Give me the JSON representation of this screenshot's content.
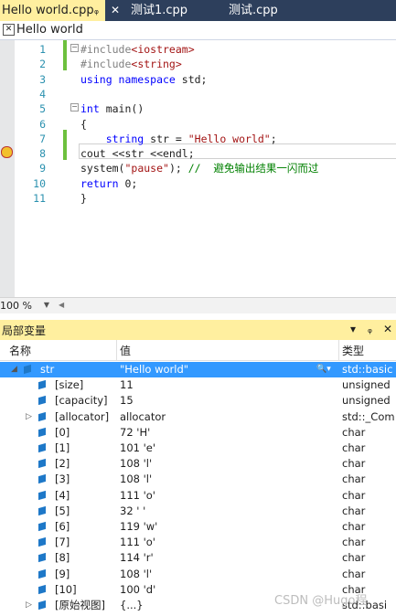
{
  "tabs": [
    {
      "label": "Hello world.cpp",
      "active": true
    },
    {
      "label": "测试1.cpp",
      "active": false
    },
    {
      "label": "测试.cpp",
      "active": false
    }
  ],
  "scope": {
    "label": "Hello world"
  },
  "editor": {
    "line_numbers": [
      "1",
      "2",
      "3",
      "4",
      "5",
      "6",
      "7",
      "8",
      "9",
      "10",
      "11"
    ],
    "lines": [
      [
        {
          "t": "#include",
          "c": "pp"
        },
        {
          "t": "<iostream>",
          "c": "str"
        }
      ],
      [
        {
          "t": "#include",
          "c": "pp"
        },
        {
          "t": "<string>",
          "c": "str"
        }
      ],
      [
        {
          "t": "using namespace ",
          "c": "kw"
        },
        {
          "t": "std;",
          "c": ""
        }
      ],
      [],
      [
        {
          "t": "int ",
          "c": "kw"
        },
        {
          "t": "main()",
          "c": ""
        }
      ],
      [
        {
          "t": "{",
          "c": ""
        }
      ],
      [
        {
          "t": "    string ",
          "c": "kw"
        },
        {
          "t": "str = ",
          "c": ""
        },
        {
          "t": "\"Hello world\"",
          "c": "str"
        },
        {
          "t": ";",
          "c": ""
        }
      ],
      [
        {
          "t": "cout <<str <<endl;",
          "c": ""
        }
      ],
      [
        {
          "t": "system(",
          "c": ""
        },
        {
          "t": "\"pause\"",
          "c": "str"
        },
        {
          "t": "); ",
          "c": ""
        },
        {
          "t": "//  避免输出结果一闪而过",
          "c": "cm"
        }
      ],
      [
        {
          "t": "return ",
          "c": "kw"
        },
        {
          "t": "0;",
          "c": ""
        }
      ],
      [
        {
          "t": "}",
          "c": ""
        }
      ]
    ]
  },
  "zoom": {
    "value": "100 %"
  },
  "locals": {
    "title": "局部变量",
    "pin": "▾ ⊣",
    "close": "✕",
    "columns": {
      "name": "名称",
      "value": "值",
      "type": "类型"
    },
    "rows": [
      {
        "name": "str",
        "value": "\"Hello world\"",
        "type": "std::basic",
        "level": 0,
        "expand": "open",
        "selected": true
      },
      {
        "name": "[size]",
        "value": "11",
        "type": "unsigned",
        "level": 1,
        "expand": "",
        "selected": false
      },
      {
        "name": "[capacity]",
        "value": "15",
        "type": "unsigned",
        "level": 1,
        "expand": "",
        "selected": false
      },
      {
        "name": "[allocator]",
        "value": "allocator",
        "type": "std::_Com",
        "level": 1,
        "expand": "closed",
        "selected": false
      },
      {
        "name": "[0]",
        "value": "72 'H'",
        "type": "char",
        "level": 1,
        "expand": "",
        "selected": false
      },
      {
        "name": "[1]",
        "value": "101 'e'",
        "type": "char",
        "level": 1,
        "expand": "",
        "selected": false
      },
      {
        "name": "[2]",
        "value": "108 'l'",
        "type": "char",
        "level": 1,
        "expand": "",
        "selected": false
      },
      {
        "name": "[3]",
        "value": "108 'l'",
        "type": "char",
        "level": 1,
        "expand": "",
        "selected": false
      },
      {
        "name": "[4]",
        "value": "111 'o'",
        "type": "char",
        "level": 1,
        "expand": "",
        "selected": false
      },
      {
        "name": "[5]",
        "value": "32 ' '",
        "type": "char",
        "level": 1,
        "expand": "",
        "selected": false
      },
      {
        "name": "[6]",
        "value": "119 'w'",
        "type": "char",
        "level": 1,
        "expand": "",
        "selected": false
      },
      {
        "name": "[7]",
        "value": "111 'o'",
        "type": "char",
        "level": 1,
        "expand": "",
        "selected": false
      },
      {
        "name": "[8]",
        "value": "114 'r'",
        "type": "char",
        "level": 1,
        "expand": "",
        "selected": false
      },
      {
        "name": "[9]",
        "value": "108 'l'",
        "type": "char",
        "level": 1,
        "expand": "",
        "selected": false
      },
      {
        "name": "[10]",
        "value": "100 'd'",
        "type": "char",
        "level": 1,
        "expand": "",
        "selected": false
      },
      {
        "name": "[原始视图]",
        "value": "{...}",
        "type": "std::basi",
        "level": 1,
        "expand": "closed",
        "selected": false
      }
    ]
  },
  "watermark": "CSDN @Hugo程"
}
